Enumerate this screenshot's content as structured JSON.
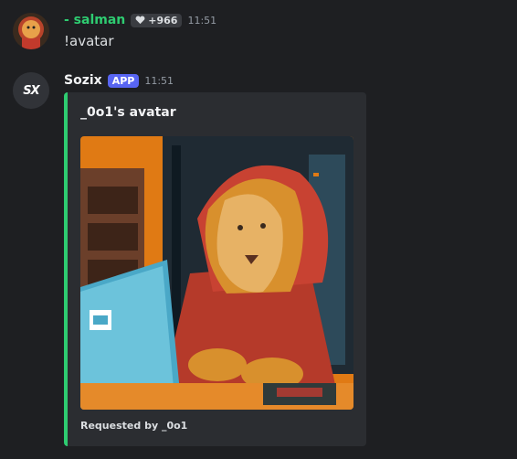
{
  "messages": {
    "first": {
      "username": "- salman",
      "username_color": "#2ecc71",
      "badge": "+966",
      "badge_icon": "heart-icon",
      "timestamp": "11:51",
      "text": "!avatar"
    },
    "second": {
      "username": "Sozix",
      "app_badge": "APP",
      "app_badge_color": "#5865f2",
      "timestamp": "11:51",
      "avatar_text": "SX",
      "embed": {
        "title": "_0o1's avatar",
        "accent_color": "#2ecc71",
        "image_description": "lion in red hoodie using laptop",
        "footer": "Requested by _0o1"
      }
    }
  }
}
